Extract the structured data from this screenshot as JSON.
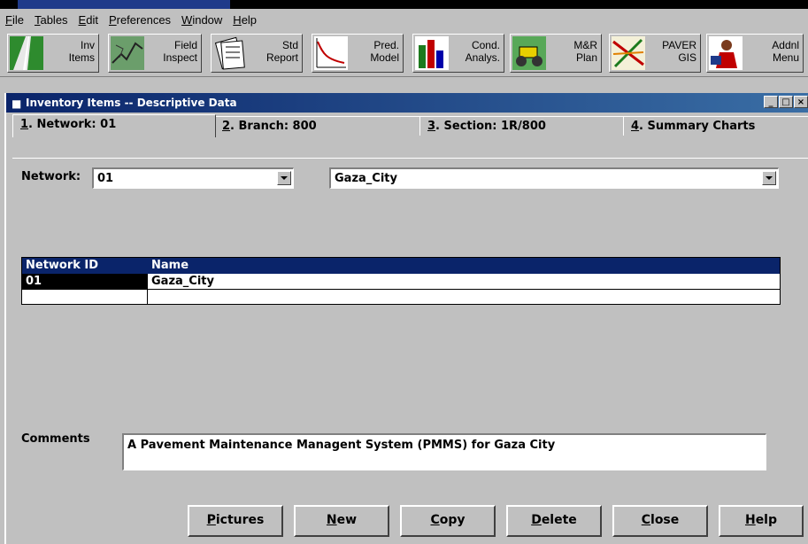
{
  "menubar": {
    "items": [
      {
        "label": "File"
      },
      {
        "label": "Tables"
      },
      {
        "label": "Edit"
      },
      {
        "label": "Preferences"
      },
      {
        "label": "Window"
      },
      {
        "label": "Help"
      }
    ]
  },
  "toolbar": {
    "buttons": [
      {
        "label": "Inv\nItems",
        "icon": "road-icon"
      },
      {
        "label": "Field\nInspect",
        "icon": "cracked-pavement-icon"
      },
      {
        "label": "Std\nReport",
        "icon": "report-pages-icon"
      },
      {
        "label": "Pred.\nModel",
        "icon": "prediction-curve-icon"
      },
      {
        "label": "Cond.\nAnalys.",
        "icon": "bar-chart-icon"
      },
      {
        "label": "M&R\nPlan",
        "icon": "roller-truck-icon"
      },
      {
        "label": "PAVER\nGIS",
        "icon": "map-icon"
      },
      {
        "label": "Addnl\nMenu",
        "icon": "person-menu-icon"
      }
    ]
  },
  "window": {
    "title": "Inventory Items -- Descriptive Data",
    "tabs": [
      {
        "num": "1",
        "rest": ". Network: 01"
      },
      {
        "num": "2",
        "rest": ". Branch: 800"
      },
      {
        "num": "3",
        "rest": ". Section: 1R/800"
      },
      {
        "num": "4",
        "rest": ". Summary Charts"
      }
    ]
  },
  "network": {
    "label": "Network:",
    "id_value": "01",
    "name_value": "Gaza_City"
  },
  "grid": {
    "headers": [
      "Network ID",
      "Name"
    ],
    "rows": [
      {
        "id": "01",
        "name": "Gaza_City"
      }
    ]
  },
  "comments": {
    "label": "Comments",
    "value": "A  Pavement Maintenance Managent System (PMMS) for Gaza City"
  },
  "buttons": [
    {
      "key": "P",
      "rest": "ictures"
    },
    {
      "key": "N",
      "rest": "ew"
    },
    {
      "key": "C",
      "rest": "opy"
    },
    {
      "key": "D",
      "rest": "elete"
    },
    {
      "key": "C",
      "rest": "lose"
    },
    {
      "key": "H",
      "rest": "elp"
    }
  ],
  "colors": {
    "title_bar": "#0a246a",
    "grid_header": "#0a246a",
    "face": "#c0c0c0"
  }
}
